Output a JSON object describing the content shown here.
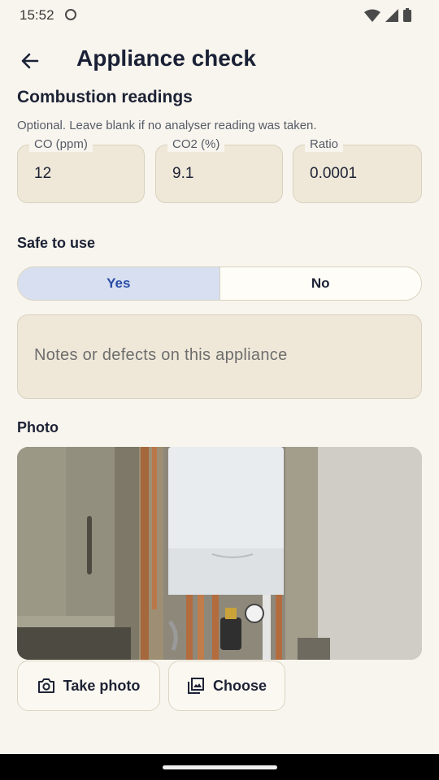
{
  "status_bar": {
    "time": "15:52"
  },
  "header": {
    "title": "Appliance check"
  },
  "combustion": {
    "title": "Combustion readings",
    "helper": "Optional. Leave blank if no analyser reading was taken.",
    "fields": [
      {
        "label": "CO (ppm)",
        "value": "12"
      },
      {
        "label": "CO2 (%)",
        "value": "9.1"
      },
      {
        "label": "Ratio",
        "value": "0.0001"
      }
    ]
  },
  "safe_to_use": {
    "title": "Safe to use",
    "yes_label": "Yes",
    "no_label": "No",
    "selected": "Yes"
  },
  "notes": {
    "placeholder": "Notes or defects on this appliance"
  },
  "photo": {
    "title": "Photo",
    "take_label": "Take photo",
    "choose_label": "Choose"
  },
  "colors": {
    "background": "#f8f5ee",
    "field_fill": "#efe8d8",
    "selected_segment": "#d7dff1",
    "selected_text": "#2a4da8"
  }
}
